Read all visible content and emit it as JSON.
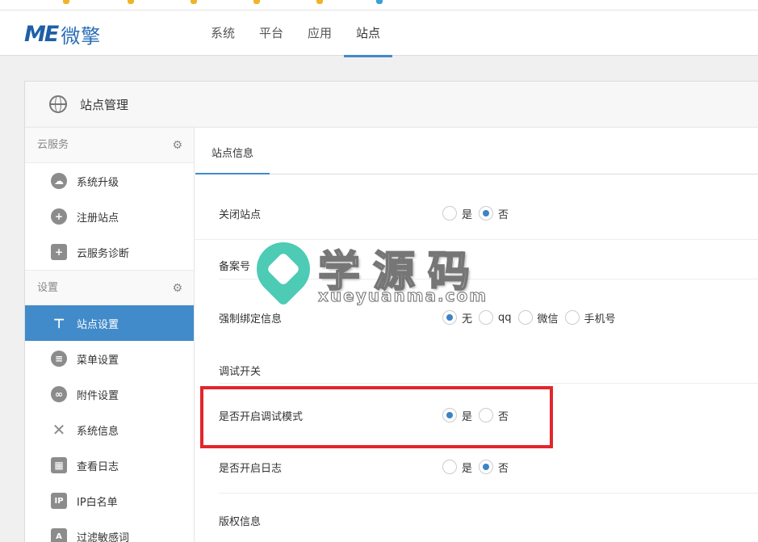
{
  "colors": {
    "accent": "#428bca",
    "highlight_border": "#e3262b",
    "logo": "#1f5fa7"
  },
  "logo": {
    "mark": "ME",
    "text": "微擎"
  },
  "nav": {
    "items": [
      "系统",
      "平台",
      "应用",
      "站点"
    ],
    "active": "站点"
  },
  "panel": {
    "title": "站点管理"
  },
  "sidebar": {
    "groups": [
      {
        "title": "云服务",
        "items": [
          {
            "label": "系统升级",
            "icon": "cloud-download-icon"
          },
          {
            "label": "注册站点",
            "icon": "plus-circle-icon"
          },
          {
            "label": "云服务诊断",
            "icon": "medkit-icon"
          }
        ]
      },
      {
        "title": "设置",
        "items": [
          {
            "label": "站点设置",
            "icon": "sitemap-icon",
            "active": true
          },
          {
            "label": "菜单设置",
            "icon": "list-icon"
          },
          {
            "label": "附件设置",
            "icon": "paperclip-icon"
          },
          {
            "label": "系统信息",
            "icon": "tools-icon"
          },
          {
            "label": "查看日志",
            "icon": "calendar-icon"
          },
          {
            "label": "IP白名单",
            "icon": "ip-icon",
            "badge": "IP"
          },
          {
            "label": "过滤敏感词",
            "icon": "text-filter-icon",
            "badge": "A"
          }
        ]
      }
    ]
  },
  "tab": {
    "label": "站点信息"
  },
  "form": {
    "close_site": {
      "label": "关闭站点",
      "options": [
        "是",
        "否"
      ],
      "selected": "否"
    },
    "icp_section": {
      "label": "备案号"
    },
    "bind_info": {
      "label": "强制绑定信息",
      "options": [
        "无",
        "qq",
        "微信",
        "手机号"
      ],
      "selected": "无"
    },
    "debug_section": {
      "label": "调试开关"
    },
    "debug_mode": {
      "label": "是否开启调试模式",
      "options": [
        "是",
        "否"
      ],
      "selected": "是"
    },
    "log": {
      "label": "是否开启日志",
      "options": [
        "是",
        "否"
      ],
      "selected": "否"
    },
    "copyright_section": {
      "label": "版权信息"
    }
  },
  "watermark": {
    "text": "学源码",
    "url": "xueyuanma.com"
  }
}
